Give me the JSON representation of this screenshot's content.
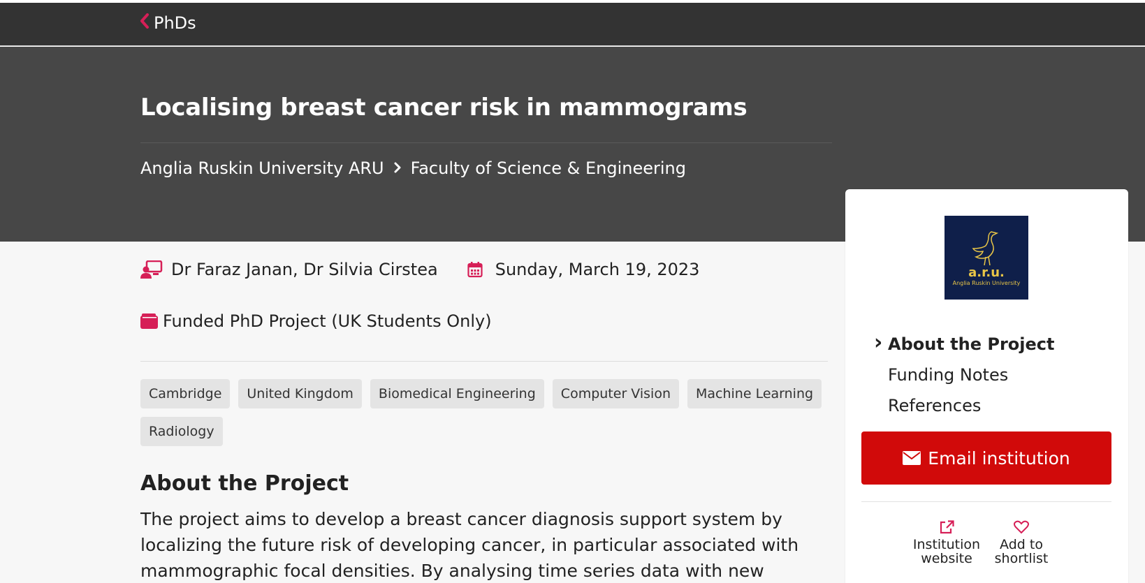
{
  "topbar": {
    "back_label": "PhDs"
  },
  "header": {
    "title": "Localising breast cancer risk in mammograms",
    "breadcrumb": [
      "Anglia Ruskin University ARU",
      "Faculty of Science & Engineering"
    ]
  },
  "meta": {
    "supervisors": "Dr Faraz Janan, Dr Silvia Cirstea",
    "date": "Sunday, March 19, 2023",
    "funding": "Funded PhD Project (UK Students Only)"
  },
  "tags": [
    "Cambridge",
    "United Kingdom",
    "Biomedical Engineering",
    "Computer Vision",
    "Machine Learning",
    "Radiology"
  ],
  "section": {
    "heading": "About the Project",
    "text": "The project aims to develop a breast cancer diagnosis support system by localizing the future risk of developing cancer, in particular associated with mammographic focal densities. By analysing time series data with new"
  },
  "sidebar": {
    "logo_text": "a.r.u.",
    "logo_sub": "Anglia Ruskin University",
    "nav": [
      "About the Project",
      "Funding Notes",
      "References"
    ],
    "email_button": "Email institution",
    "actions": [
      {
        "label": "Institution website",
        "icon": "external-link-icon"
      },
      {
        "label": "Add to shortlist",
        "icon": "heart-icon"
      }
    ]
  },
  "colors": {
    "accent": "#d61f57",
    "button_red": "#d10a0a",
    "hero_bg": "#474747",
    "topbar_bg": "#333333"
  }
}
